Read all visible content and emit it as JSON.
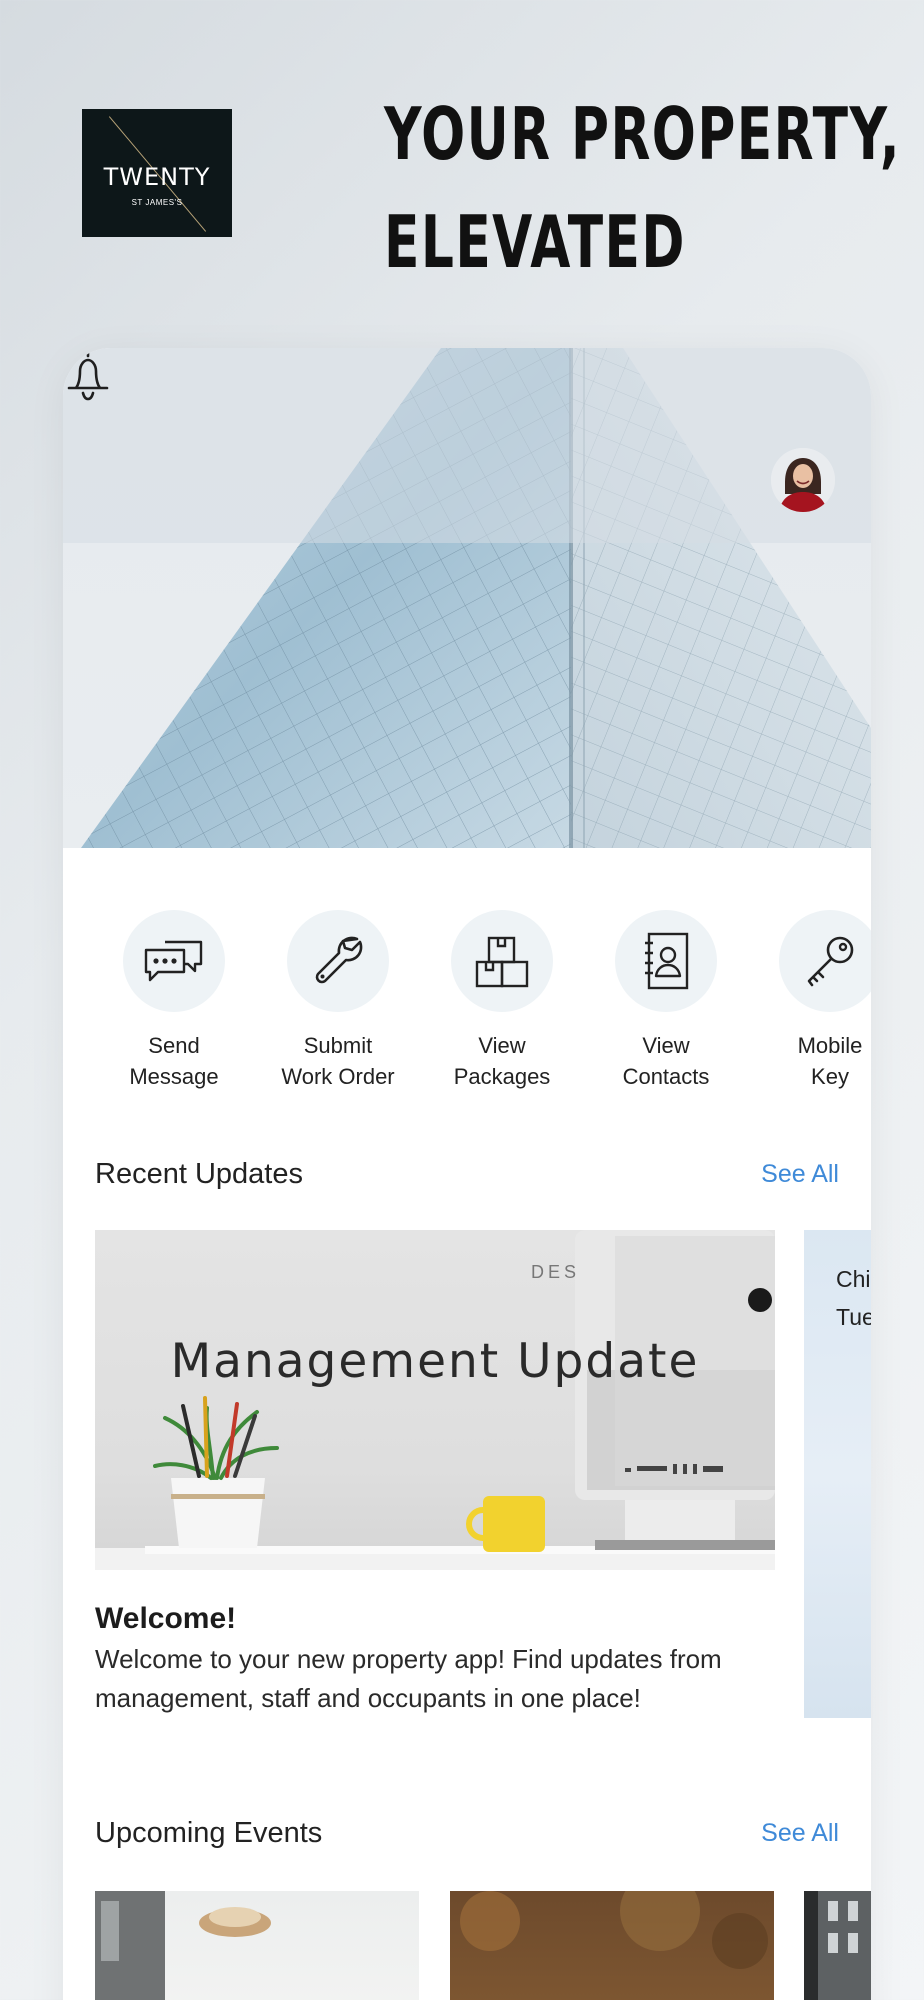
{
  "brand": {
    "logo_name": "TWENTY",
    "logo_sub": "ST JAMES'S"
  },
  "headline": {
    "line1": "YOUR PROPERTY,",
    "line2": "ELEVATED"
  },
  "icons": {
    "notifications": "bell-icon",
    "profile": "avatar"
  },
  "quick_actions": [
    {
      "label": "Send\nMessage",
      "icon": "chat-bubbles-icon"
    },
    {
      "label": "Submit\nWork Order",
      "icon": "wrench-icon"
    },
    {
      "label": "View\nPackages",
      "icon": "boxes-icon"
    },
    {
      "label": "View\nContacts",
      "icon": "contact-book-icon"
    },
    {
      "label": "Mobile\nKey",
      "icon": "key-icon"
    }
  ],
  "recent_updates": {
    "title": "Recent Updates",
    "see_all": "See All",
    "card": {
      "image_text": "Management Update",
      "heading": "Welcome!",
      "body": "Welcome to your new property app! Find updates from management, staff and occupants in one place!"
    },
    "next_card_partial": {
      "line1": "Chi",
      "line2": "Tue"
    }
  },
  "upcoming_events": {
    "title": "Upcoming Events",
    "see_all": "See All"
  },
  "colors": {
    "accent": "#3f8ad8",
    "logo_bg": "#0d1719",
    "icon_circle": "#eef3f6"
  }
}
